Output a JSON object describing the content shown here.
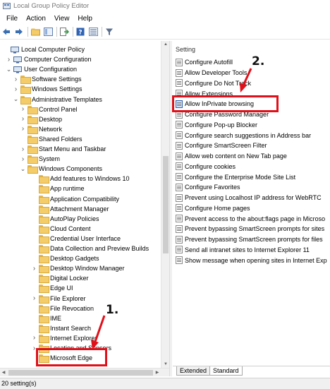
{
  "window": {
    "title": "Local Group Policy Editor"
  },
  "menu": {
    "file": "File",
    "action": "Action",
    "view": "View",
    "help": "Help"
  },
  "toolbar": [
    "back-icon",
    "forward-icon",
    "up-folder-icon",
    "show-hide-tree-icon",
    "export-icon",
    "help-icon",
    "properties-icon",
    "filter-icon"
  ],
  "tree": {
    "items": [
      {
        "label": "Local Computer Policy",
        "level": 0,
        "chevron": "",
        "icon": "computer-policy-icon"
      },
      {
        "label": "Computer Configuration",
        "level": 1,
        "chevron": "right",
        "icon": "computer-config-icon"
      },
      {
        "label": "User Configuration",
        "level": 1,
        "chevron": "down",
        "icon": "user-config-icon"
      },
      {
        "label": "Software Settings",
        "level": 2,
        "chevron": "right",
        "icon": "folder"
      },
      {
        "label": "Windows Settings",
        "level": 2,
        "chevron": "right",
        "icon": "folder"
      },
      {
        "label": "Administrative Templates",
        "level": 2,
        "chevron": "down",
        "icon": "folder"
      },
      {
        "label": "Control Panel",
        "level": 3,
        "chevron": "right",
        "icon": "folder"
      },
      {
        "label": "Desktop",
        "level": 3,
        "chevron": "right",
        "icon": "folder"
      },
      {
        "label": "Network",
        "level": 3,
        "chevron": "right",
        "icon": "folder"
      },
      {
        "label": "Shared Folders",
        "level": 3,
        "chevron": "",
        "icon": "folder"
      },
      {
        "label": "Start Menu and Taskbar",
        "level": 3,
        "chevron": "right",
        "icon": "folder"
      },
      {
        "label": "System",
        "level": 3,
        "chevron": "right",
        "icon": "folder"
      },
      {
        "label": "Windows Components",
        "level": 3,
        "chevron": "down",
        "icon": "folder"
      },
      {
        "label": "Add features to Windows 10",
        "level": 4,
        "chevron": "",
        "icon": "folder"
      },
      {
        "label": "App runtime",
        "level": 4,
        "chevron": "",
        "icon": "folder"
      },
      {
        "label": "Application Compatibility",
        "level": 4,
        "chevron": "",
        "icon": "folder"
      },
      {
        "label": "Attachment Manager",
        "level": 4,
        "chevron": "",
        "icon": "folder"
      },
      {
        "label": "AutoPlay Policies",
        "level": 4,
        "chevron": "",
        "icon": "folder"
      },
      {
        "label": "Cloud Content",
        "level": 4,
        "chevron": "",
        "icon": "folder"
      },
      {
        "label": "Credential User Interface",
        "level": 4,
        "chevron": "",
        "icon": "folder"
      },
      {
        "label": "Data Collection and Preview Builds",
        "level": 4,
        "chevron": "",
        "icon": "folder"
      },
      {
        "label": "Desktop Gadgets",
        "level": 4,
        "chevron": "",
        "icon": "folder"
      },
      {
        "label": "Desktop Window Manager",
        "level": 4,
        "chevron": "right",
        "icon": "folder"
      },
      {
        "label": "Digital Locker",
        "level": 4,
        "chevron": "",
        "icon": "folder"
      },
      {
        "label": "Edge UI",
        "level": 4,
        "chevron": "",
        "icon": "folder"
      },
      {
        "label": "File Explorer",
        "level": 4,
        "chevron": "right",
        "icon": "folder"
      },
      {
        "label": "File Revocation",
        "level": 4,
        "chevron": "",
        "icon": "folder"
      },
      {
        "label": "IME",
        "level": 4,
        "chevron": "",
        "icon": "folder"
      },
      {
        "label": "Instant Search",
        "level": 4,
        "chevron": "",
        "icon": "folder"
      },
      {
        "label": "Internet Explorer",
        "level": 4,
        "chevron": "right",
        "icon": "folder"
      },
      {
        "label": "Location and Sensors",
        "level": 4,
        "chevron": "right",
        "icon": "folder"
      },
      {
        "label": "Microsoft Edge",
        "level": 4,
        "chevron": "",
        "icon": "folder",
        "selected": true
      }
    ]
  },
  "list": {
    "header": "Setting",
    "items": [
      "Configure Autofill",
      "Allow Developer Tools",
      "Configure Do Not Track",
      "Allow Extensions",
      "Allow InPrivate browsing",
      "Configure Password Manager",
      "Configure Pop-up Blocker",
      "Configure search suggestions in Address bar",
      "Configure SmartScreen Filter",
      "Allow web content on New Tab page",
      "Configure cookies",
      "Configure the Enterprise Mode Site List",
      "Configure Favorites",
      "Prevent using Localhost IP address for WebRTC",
      "Configure Home pages",
      "Prevent access to the about:flags page in Microso",
      "Prevent bypassing SmartScreen prompts for sites",
      "Prevent bypassing SmartScreen prompts for files",
      "Send all intranet sites to Internet Explorer 11",
      "Show message when opening sites in Internet Exp"
    ],
    "selected_index": 4
  },
  "tabs": {
    "extended": "Extended",
    "standard": "Standard",
    "active": "standard"
  },
  "status": {
    "text": "20 setting(s)"
  },
  "annotations": {
    "step1": "1.",
    "step2": "2.",
    "color": "#e0101a"
  }
}
